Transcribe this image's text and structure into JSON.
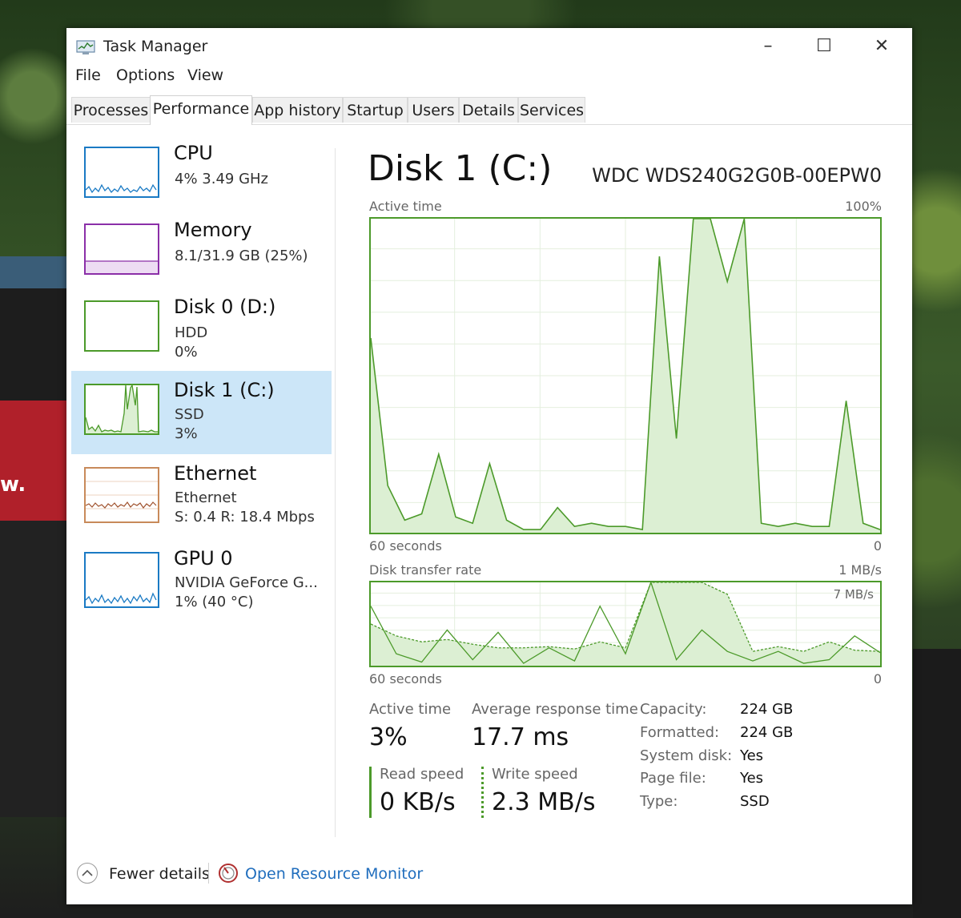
{
  "window": {
    "title": "Task Manager",
    "controls": {
      "minimize": "–",
      "maximize": "☐",
      "close": "✕"
    }
  },
  "menu": [
    "File",
    "Options",
    "View"
  ],
  "tabs": [
    "Processes",
    "Performance",
    "App history",
    "Startup",
    "Users",
    "Details",
    "Services"
  ],
  "active_tab": "Performance",
  "sidebar": [
    {
      "title": "CPU",
      "sub1": "4%  3.49 GHz",
      "sub2": "",
      "color": "#1a7ac4"
    },
    {
      "title": "Memory",
      "sub1": "8.1/31.9 GB (25%)",
      "sub2": "",
      "color": "#8b2fa8"
    },
    {
      "title": "Disk 0 (D:)",
      "sub1": "HDD",
      "sub2": "0%",
      "color": "#4c9a2a"
    },
    {
      "title": "Disk 1 (C:)",
      "sub1": "SSD",
      "sub2": "3%",
      "color": "#4c9a2a"
    },
    {
      "title": "Ethernet",
      "sub1": "Ethernet",
      "sub2": "S: 0.4  R: 18.4 Mbps",
      "color": "#a0522d"
    },
    {
      "title": "GPU 0",
      "sub1": "NVIDIA GeForce G...",
      "sub2": "1%  (40 °C)",
      "color": "#1a7ac4"
    }
  ],
  "selected_sidebar": "Disk 1 (C:)",
  "detail": {
    "title": "Disk 1 (C:)",
    "model": "WDC WDS240G2G0B-00EPW0",
    "active_chart": {
      "label": "Active time",
      "max_label": "100%",
      "x_left": "60 seconds",
      "x_right": "0"
    },
    "transfer_chart": {
      "label": "Disk transfer rate",
      "max_label": "1 MB/s",
      "inner_label": "7 MB/s",
      "x_left": "60 seconds",
      "x_right": "0"
    },
    "stats": {
      "active_time_label": "Active time",
      "active_time_value": "3%",
      "avg_response_label": "Average response time",
      "avg_response_value": "17.7 ms",
      "read_label": "Read speed",
      "read_value": "0 KB/s",
      "write_label": "Write speed",
      "write_value": "2.3 MB/s"
    },
    "properties": [
      {
        "key": "Capacity:",
        "value": "224 GB"
      },
      {
        "key": "Formatted:",
        "value": "224 GB"
      },
      {
        "key": "System disk:",
        "value": "Yes"
      },
      {
        "key": "Page file:",
        "value": "Yes"
      },
      {
        "key": "Type:",
        "value": "SSD"
      }
    ]
  },
  "footer": {
    "fewer_details": "Fewer details",
    "open_resource_monitor": "Open Resource Monitor"
  },
  "background": {
    "car_text": "w."
  },
  "chart_data": [
    {
      "type": "area",
      "title": "Active time",
      "ylim": [
        0,
        100
      ],
      "x": [
        60,
        58,
        56,
        54,
        52,
        50,
        48,
        46,
        44,
        42,
        40,
        38,
        36,
        34,
        32,
        30,
        28,
        26,
        24,
        22,
        20,
        18,
        16,
        14,
        12,
        10,
        8,
        6,
        4,
        2,
        0
      ],
      "series": [
        {
          "values": [
            62,
            15,
            4,
            6,
            25,
            5,
            3,
            22,
            4,
            1,
            1,
            8,
            2,
            3,
            2,
            2,
            1,
            88,
            30,
            100,
            100,
            80,
            100,
            3,
            2,
            3,
            2,
            2,
            42,
            3,
            1
          ]
        }
      ]
    },
    {
      "type": "line",
      "title": "Disk transfer rate",
      "ylim": [
        0,
        7
      ],
      "x": [
        60,
        57,
        54,
        51,
        48,
        45,
        42,
        39,
        36,
        33,
        30,
        27,
        24,
        21,
        18,
        15,
        12,
        9,
        6,
        3,
        0
      ],
      "series": [
        {
          "name": "Read speed",
          "values": [
            5,
            1,
            0.3,
            3,
            0.5,
            2.8,
            0.2,
            1.5,
            0.4,
            5,
            1,
            7,
            0.5,
            3,
            1.2,
            0.4,
            1.2,
            0.2,
            0.5,
            2.5,
            1.1
          ]
        },
        {
          "name": "Write speed",
          "values": [
            3.5,
            2.5,
            2,
            2.2,
            1.8,
            1.5,
            1.5,
            1.6,
            1.4,
            2,
            1.5,
            7,
            7,
            7,
            6,
            1.2,
            1.6,
            1.2,
            2,
            1.3,
            1.2
          ]
        }
      ]
    }
  ]
}
